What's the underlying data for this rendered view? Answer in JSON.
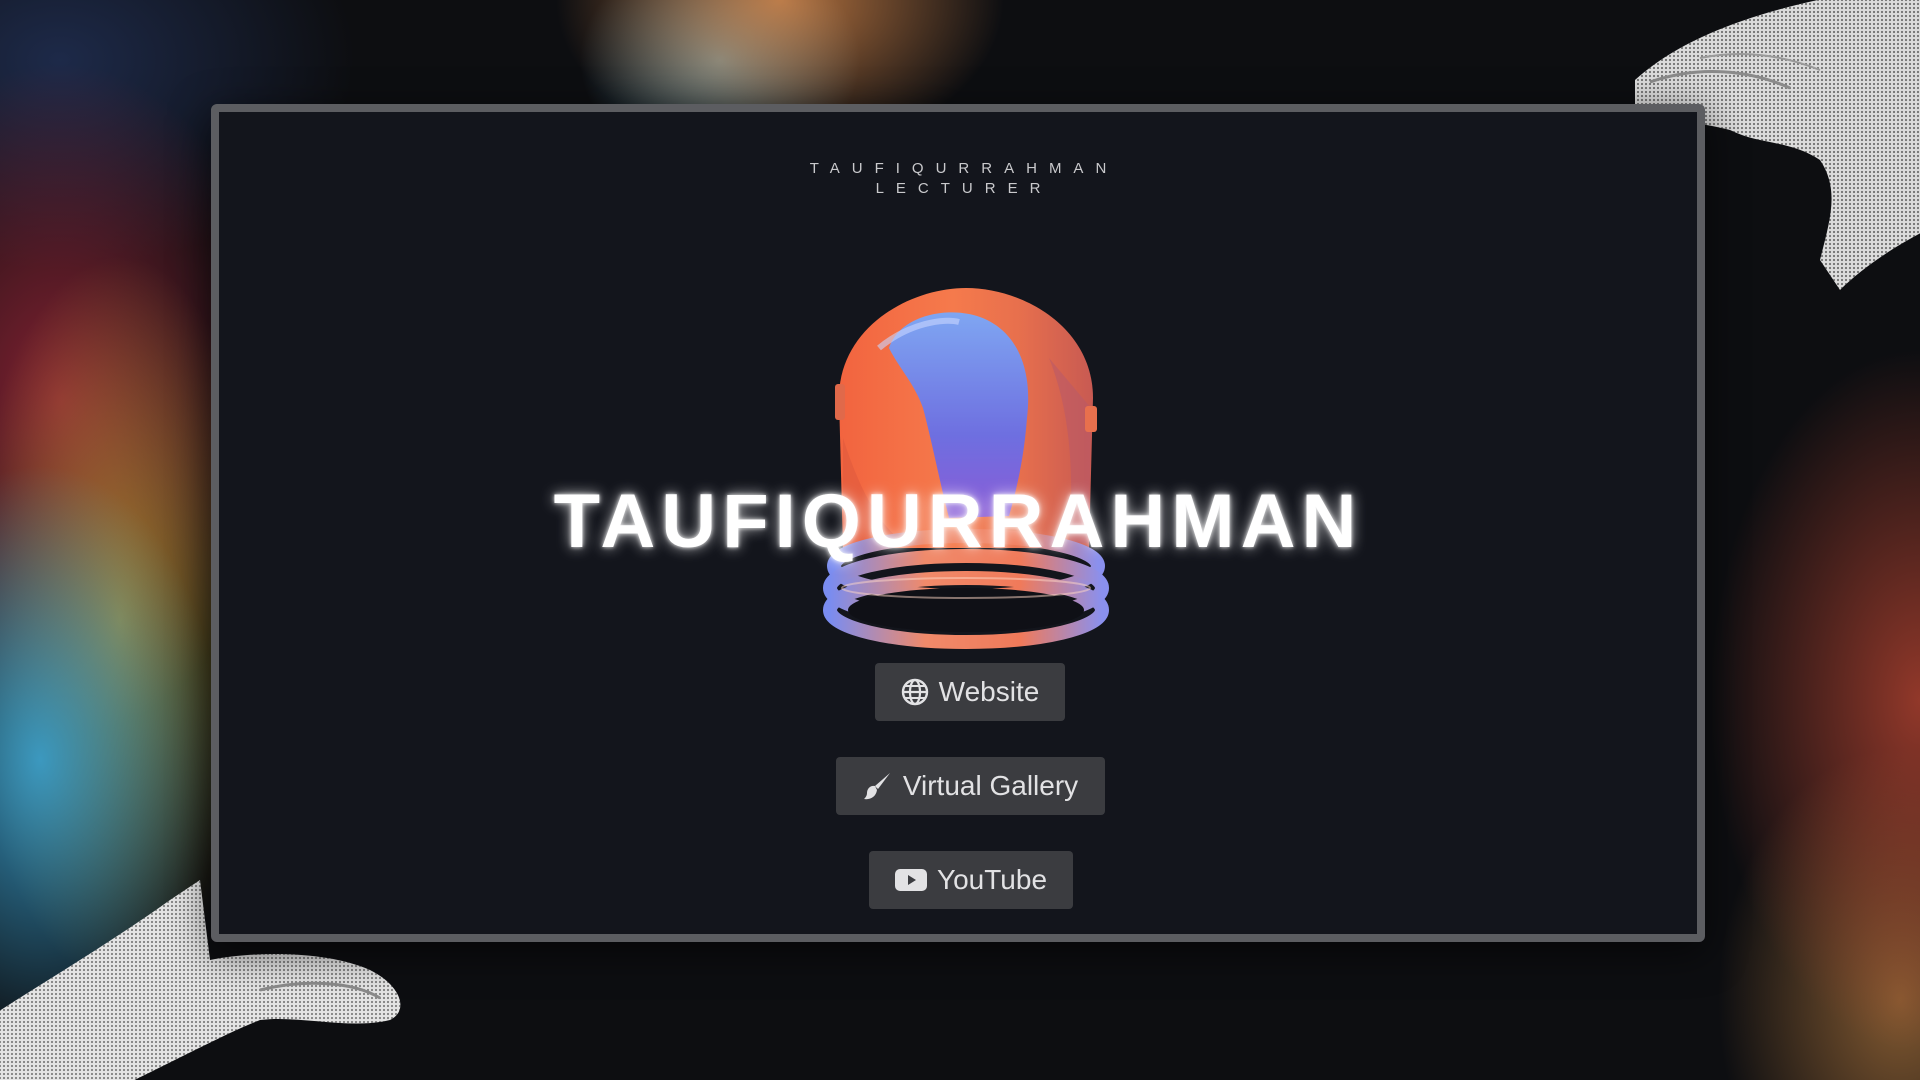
{
  "header": {
    "name": "TAUFIQURRAHMAN",
    "role": "LECTURER"
  },
  "hero": {
    "title": "TAUFIQURRAHMAN"
  },
  "links": [
    {
      "label": "Website",
      "icon": "globe-icon"
    },
    {
      "label": "Virtual Gallery",
      "icon": "paintbrush-icon"
    },
    {
      "label": "YouTube",
      "icon": "youtube-icon"
    }
  ],
  "colors": {
    "window_bg": "#13151c",
    "window_border": "#5c5d61",
    "button_bg": "#3b3c40",
    "helmet_orange": "#f26a4a",
    "helmet_blue": "#6f8ff0"
  }
}
